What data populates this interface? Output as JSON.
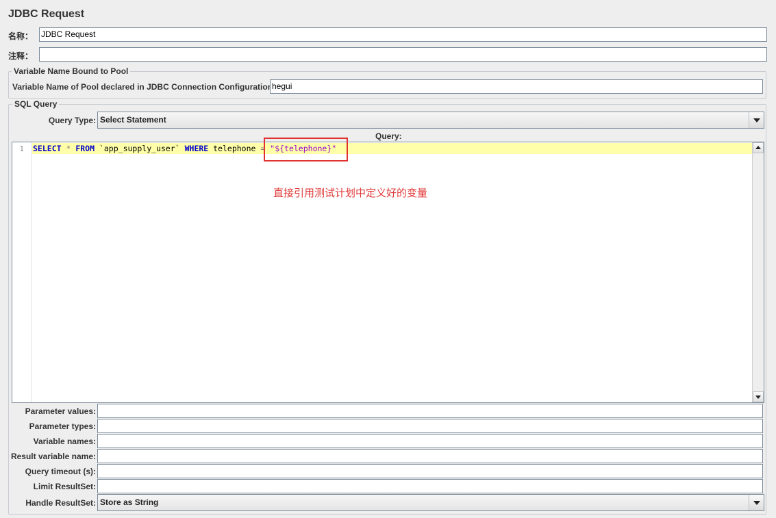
{
  "title": "JDBC Request",
  "name_label": "名称：",
  "name_value": "JDBC Request",
  "comment_label": "注释：",
  "comment_value": "",
  "pool_group": {
    "title": "Variable Name Bound to Pool",
    "label": "Variable Name of Pool declared in JDBC Connection Configuration:",
    "value": "hegui"
  },
  "sql_group": {
    "title": "SQL Query",
    "query_type_label": "Query Type:",
    "query_type_value": "Select Statement",
    "query_label": "Query:"
  },
  "editor": {
    "line_number": "1",
    "code": {
      "kw_select": "SELECT",
      "star": " * ",
      "kw_from": "FROM",
      "table": " `app_supply_user` ",
      "kw_where": "WHERE",
      "column": " telephone ",
      "eq": "=",
      "space": " ",
      "value": "\"${telephone}\""
    }
  },
  "annotation": "直接引用测试计划中定义好的变量",
  "params": {
    "parameter_values_label": "Parameter values:",
    "parameter_values": "",
    "parameter_types_label": "Parameter types:",
    "parameter_types": "",
    "variable_names_label": "Variable names:",
    "variable_names": "",
    "result_variable_name_label": "Result variable name:",
    "result_variable_name": "",
    "query_timeout_label": "Query timeout (s):",
    "query_timeout": "",
    "limit_resultset_label": "Limit ResultSet:",
    "limit_resultset": "",
    "handle_resultset_label": "Handle ResultSet:",
    "handle_resultset_value": "Store as String"
  },
  "colors": {
    "annotation": "#e03a3a",
    "highlight_line": "#ffffaa",
    "keyword": "#0000cc",
    "string": "#9900cc"
  }
}
